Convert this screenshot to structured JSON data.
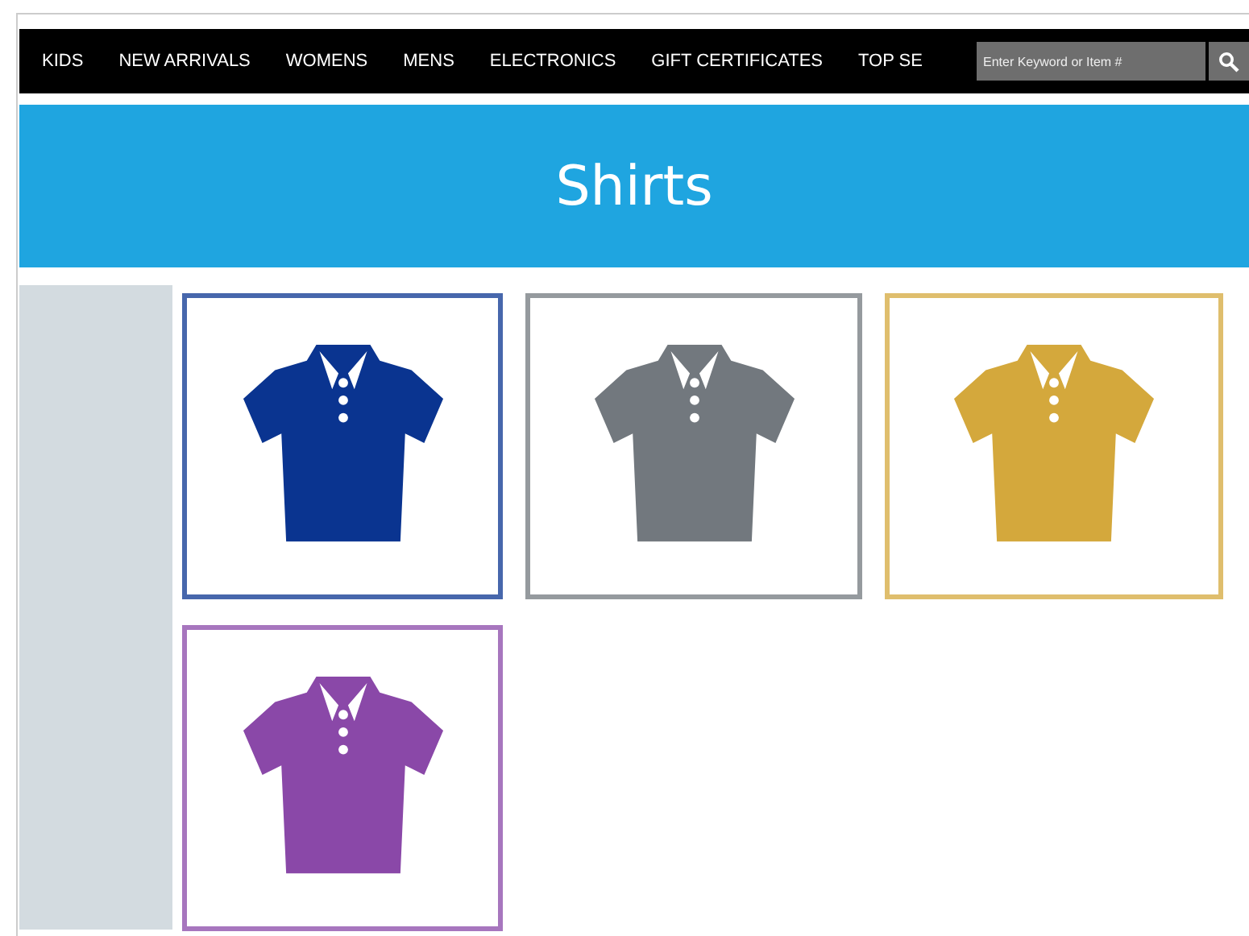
{
  "nav": {
    "items": [
      {
        "label": "KIDS"
      },
      {
        "label": "NEW ARRIVALS"
      },
      {
        "label": "WOMENS"
      },
      {
        "label": "MENS"
      },
      {
        "label": "ELECTRONICS"
      },
      {
        "label": "GIFT CERTIFICATES"
      },
      {
        "label": "TOP SE"
      }
    ],
    "search": {
      "placeholder": "Enter Keyword or Item #"
    }
  },
  "banner": {
    "title": "Shirts"
  },
  "products": [
    {
      "color": "#0a3490"
    },
    {
      "color": "#72787e"
    },
    {
      "color": "#d4a83c"
    },
    {
      "color": "#8a48a8"
    }
  ]
}
